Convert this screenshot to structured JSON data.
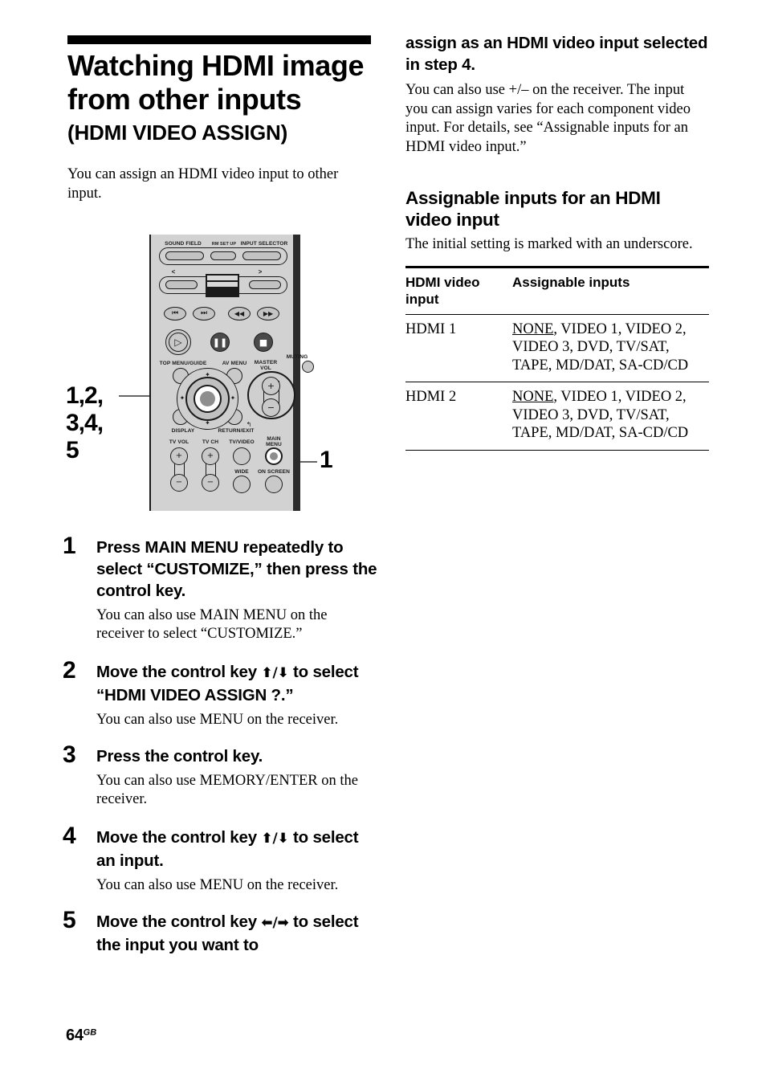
{
  "document": {
    "title_line1": "Watching HDMI image",
    "title_line2": "from other inputs",
    "subtitle": "(HDMI VIDEO ASSIGN)",
    "intro": "You can assign an HDMI video input to other input."
  },
  "figure": {
    "callout_left": "1,2,\n3,4,\n5",
    "callout_left_l1": "1,2,",
    "callout_left_l2": "3,4,",
    "callout_left_l3": "5",
    "callout_right": "1",
    "remote_labels": {
      "sound_field": "SOUND FIELD",
      "rm_set_up": "RM SET UP",
      "input_selector": "INPUT SELECTOR",
      "prev_arrow": "<",
      "next_arrow": ">",
      "top_menu_guide": "TOP MENU/GUIDE",
      "av_menu": "AV MENU",
      "master_vol_l1": "MASTER",
      "master_vol_l2": "VOL",
      "muting": "MUTING",
      "display": "DISPLAY",
      "return_exit": "RETURN/EXIT",
      "tv_vol": "TV VOL",
      "tv_ch": "TV CH",
      "tv_video": "TV/VIDEO",
      "main_menu_l1": "MAIN",
      "main_menu_l2": "MENU",
      "wide": "WIDE",
      "on_screen": "ON SCREEN",
      "plus": "+",
      "minus": "−"
    }
  },
  "steps": [
    {
      "num": "1",
      "head": "Press MAIN MENU repeatedly to select “CUSTOMIZE,” then press the control key.",
      "body": "You can also use MAIN MENU on the receiver to select “CUSTOMIZE.”"
    },
    {
      "num": "2",
      "head_pre": "Move the control key ",
      "head_arrows": "⬆/⬇",
      "head_post": " to select “HDMI VIDEO ASSIGN ?.”",
      "body": "You can also use MENU on the receiver."
    },
    {
      "num": "3",
      "head": "Press the control key.",
      "body": "You can also use MEMORY/ENTER on the receiver."
    },
    {
      "num": "4",
      "head_pre": "Move the control key ",
      "head_arrows": "⬆/⬇",
      "head_post": " to select an input.",
      "body": "You can also use MENU on the receiver."
    },
    {
      "num": "5",
      "head_pre": "Move the control key ",
      "head_arrows": "⬅/➡",
      "head_post": " to select the input you want to",
      "body": ""
    }
  ],
  "right_column": {
    "continuation_head": "assign as an HDMI video input selected in step 4.",
    "continuation_body": "You can also use +/– on the receiver. The input you can assign varies for each component video input. For details, see “Assignable inputs for an HDMI video input.”",
    "section_head": "Assignable inputs for an HDMI video input",
    "section_sub": "The initial setting is marked with an underscore.",
    "table": {
      "headers": [
        "HDMI video input",
        "Assignable inputs"
      ],
      "rows": [
        {
          "input": "HDMI 1",
          "default": "NONE",
          "rest": ", VIDEO 1, VIDEO 2, VIDEO 3, DVD, TV/SAT, TAPE, MD/DAT, SA-CD/CD"
        },
        {
          "input": "HDMI 2",
          "default": "NONE",
          "rest": ", VIDEO 1, VIDEO 2, VIDEO 3, DVD, TV/SAT, TAPE, MD/DAT, SA-CD/CD"
        }
      ]
    }
  },
  "footer": {
    "page_number": "64",
    "region": "GB"
  },
  "colors": {
    "remote_body": "#d2d2d2",
    "remote_edge": "#2b2b2b",
    "rule": "#000000",
    "leader": "#666666"
  }
}
